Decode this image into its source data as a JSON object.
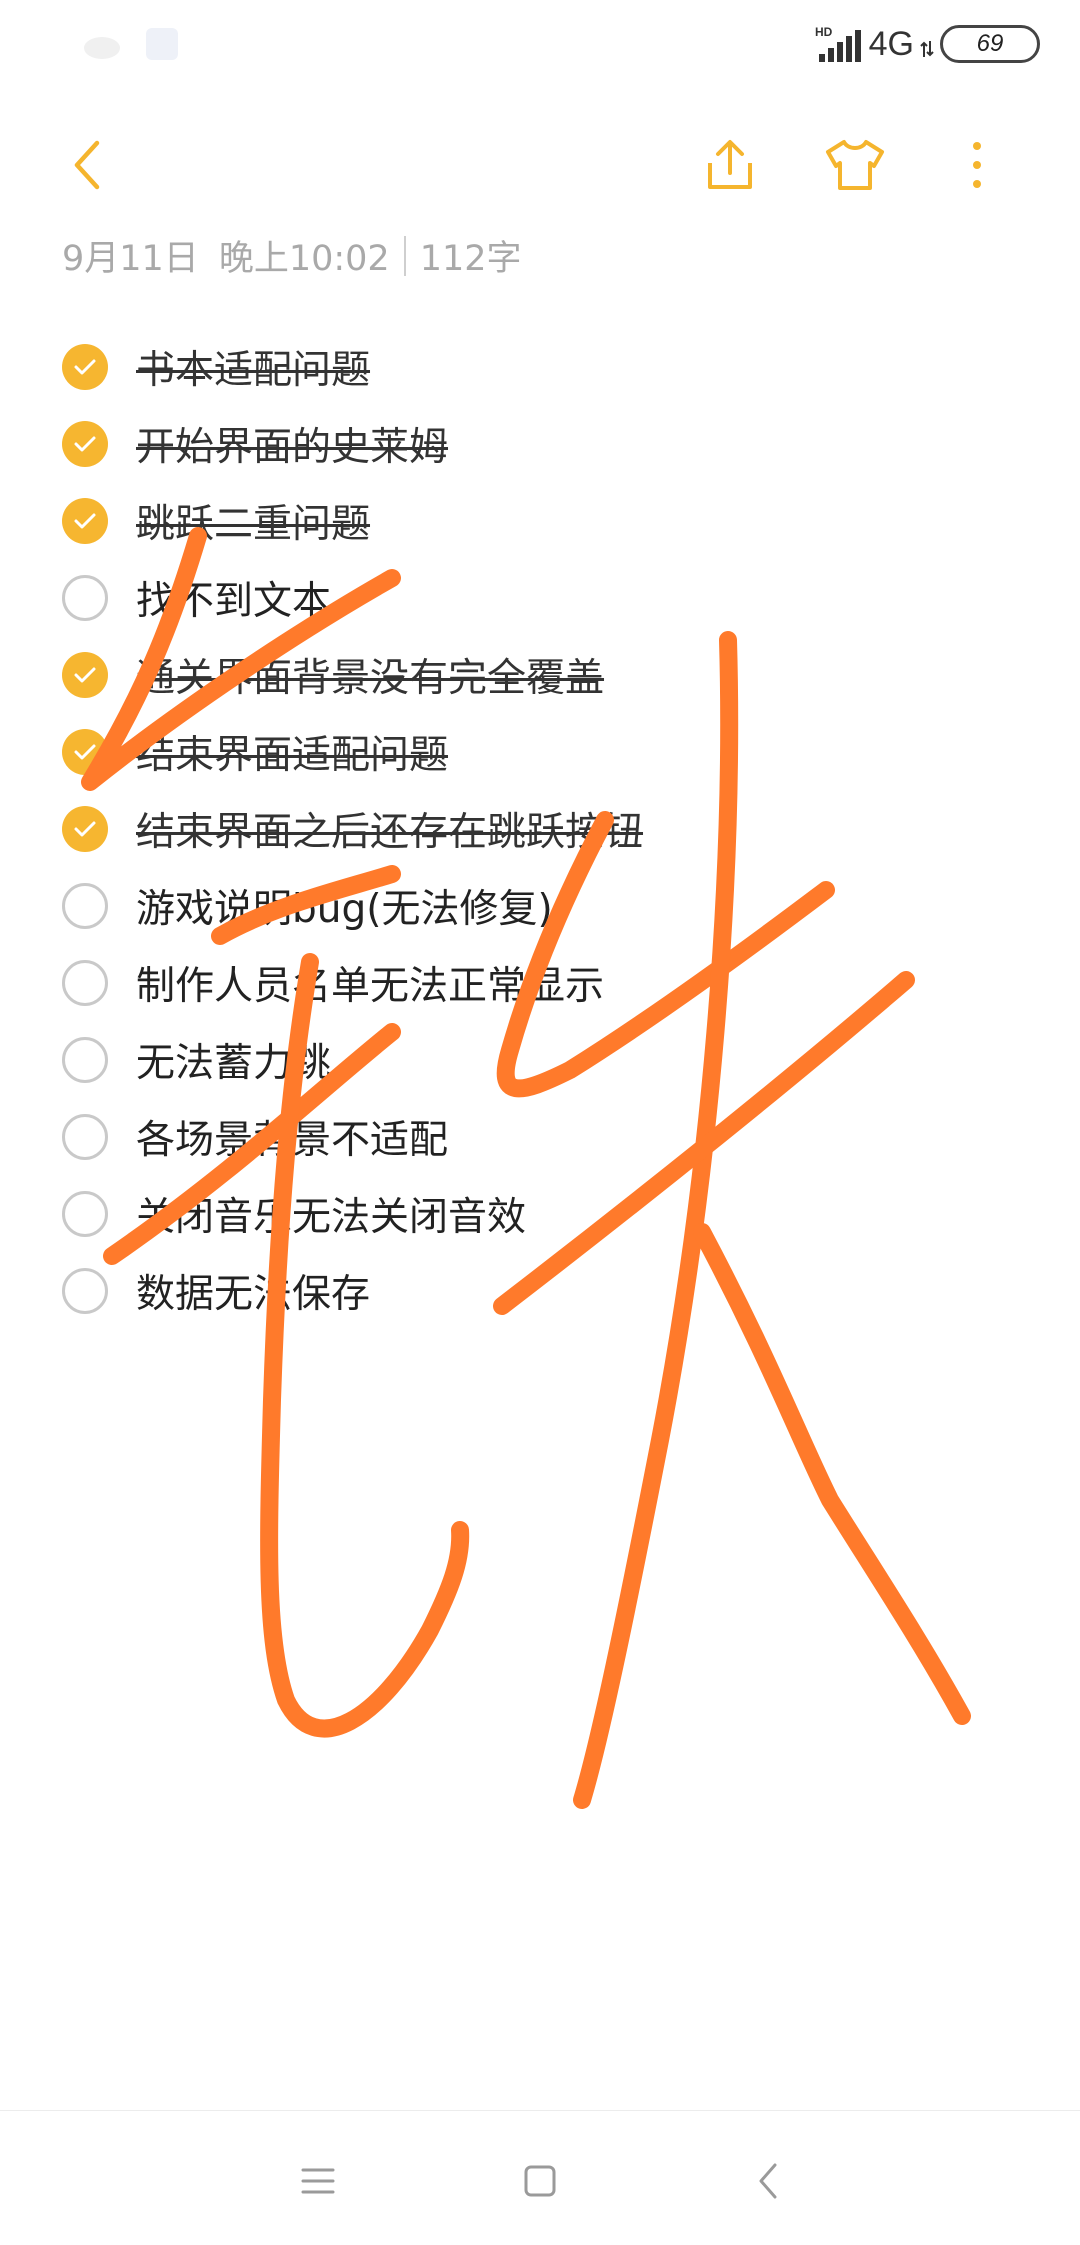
{
  "status_bar": {
    "network_label": "4G",
    "hd_label": "HD",
    "battery_level": "69"
  },
  "toolbar": {
    "back_icon": "chevron-left-icon",
    "share_icon": "share-icon",
    "theme_icon": "tshirt-icon",
    "more_icon": "more-vertical-icon",
    "accent_color": "#f5b52e"
  },
  "note_meta": {
    "date": "9月11日",
    "time": "晚上10:02",
    "char_count": "112字"
  },
  "checklist": [
    {
      "text": "书本适配问题",
      "done": true
    },
    {
      "text": "开始界面的史莱姆",
      "done": true
    },
    {
      "text": "跳跃二重问题",
      "done": true
    },
    {
      "text": "找不到文本",
      "done": false
    },
    {
      "text": "通关界面背景没有完全覆盖",
      "done": true
    },
    {
      "text": "结束界面适配问题",
      "done": true
    },
    {
      "text": "结束界面之后还存在跳跃按钮",
      "done": true
    },
    {
      "text": "游戏说明bug(无法修复)",
      "done": false
    },
    {
      "text": "制作人员名单无法正常显示",
      "done": false
    },
    {
      "text": "无法蓄力跳",
      "done": false
    },
    {
      "text": "各场景背景不适配",
      "done": false
    },
    {
      "text": "关闭音乐无法关闭音效",
      "done": false
    },
    {
      "text": "数据无法保存",
      "done": false
    }
  ],
  "colors": {
    "check_on": "#f6b630",
    "scribble": "#ff7a2b"
  },
  "nav_bar": {
    "menu_icon": "menu-icon",
    "home_icon": "square-icon",
    "back_icon": "back-triangle-icon"
  }
}
